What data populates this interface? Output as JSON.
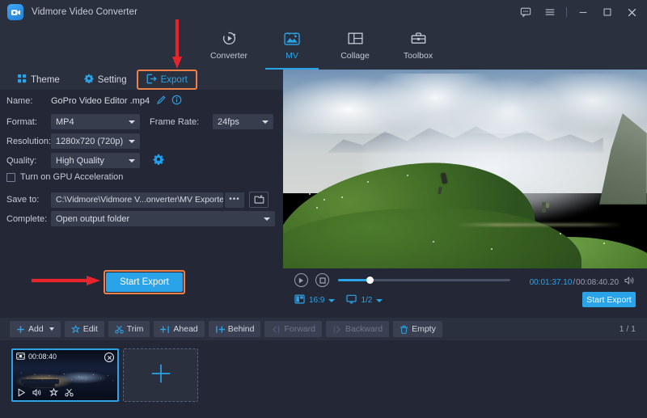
{
  "window": {
    "app_title": "Vidmore Video Converter",
    "logo_icon": "video-camera-icon",
    "controls": {
      "feedback_label": "feedback-icon",
      "menu_label": "hamburger-menu-icon",
      "minimize_label": "minimize-icon",
      "maximize_label": "maximize-icon",
      "close_label": "close-icon"
    }
  },
  "mainnav": {
    "items": [
      {
        "label": "Converter",
        "icon": "converter-icon",
        "active": false
      },
      {
        "label": "MV",
        "icon": "mv-icon",
        "active": true
      },
      {
        "label": "Collage",
        "icon": "collage-icon",
        "active": false
      },
      {
        "label": "Toolbox",
        "icon": "toolbox-icon",
        "active": false
      }
    ]
  },
  "subnav": {
    "items": [
      {
        "label": "Theme",
        "icon": "grid-icon",
        "active": false
      },
      {
        "label": "Setting",
        "icon": "gear-icon",
        "active": false
      },
      {
        "label": "Export",
        "icon": "export-icon",
        "active": true,
        "highlighted": true
      }
    ]
  },
  "export_form": {
    "name_label": "Name:",
    "name_value": "GoPro Video Editor .mp4",
    "name_edit_icon": "pencil-icon",
    "name_info_icon": "info-icon",
    "format_label": "Format:",
    "format_value": "MP4",
    "frame_rate_label": "Frame Rate:",
    "frame_rate_value": "24fps",
    "resolution_label": "Resolution:",
    "resolution_value": "1280x720 (720p)",
    "quality_label": "Quality:",
    "quality_value": "High Quality",
    "quality_settings_icon": "gear-icon",
    "gpu_label": "Turn on GPU Acceleration",
    "gpu_checked": false,
    "save_to_label": "Save to:",
    "save_to_value": "C:\\Vidmore\\Vidmore V...onverter\\MV Exported",
    "browse_ellipsis_label": "•••",
    "folder_icon": "folder-icon",
    "complete_label": "Complete:",
    "complete_value": "Open output folder",
    "start_export_label": "Start Export"
  },
  "annotations": {
    "arrow_color": "#e8242a",
    "highlight_color": "#ee8149"
  },
  "player": {
    "play_icon": "play-icon",
    "stop_icon": "stop-icon",
    "progress_percent": 18.7,
    "current_time": "00:01:37.10",
    "time_separator": "/",
    "total_time": "00:08:40.20",
    "volume_icon": "volume-icon",
    "aspect_icon": "aspect-ratio-icon",
    "aspect_value": "16:9",
    "screen_icon": "monitor-icon",
    "screen_value": "1/2",
    "start_export_label": "Start Export"
  },
  "toolbar": {
    "buttons": [
      {
        "label": "Add",
        "icon": "plus-icon",
        "disabled": false,
        "has_caret": true
      },
      {
        "label": "Edit",
        "icon": "magic-wand-icon",
        "disabled": false,
        "has_caret": false
      },
      {
        "label": "Trim",
        "icon": "scissors-icon",
        "disabled": false,
        "has_caret": false
      },
      {
        "label": "Ahead",
        "icon": "insert-ahead-icon",
        "disabled": false,
        "has_caret": false
      },
      {
        "label": "Behind",
        "icon": "insert-behind-icon",
        "disabled": false,
        "has_caret": false
      },
      {
        "label": "Forward",
        "icon": "move-forward-icon",
        "disabled": true,
        "has_caret": false
      },
      {
        "label": "Backward",
        "icon": "move-backward-icon",
        "disabled": true,
        "has_caret": false
      },
      {
        "label": "Empty",
        "icon": "trash-icon",
        "disabled": false,
        "has_caret": false
      }
    ],
    "page_indicator": "1 / 1"
  },
  "strip": {
    "clip": {
      "duration": "00:08:40",
      "film_icon": "film-strip-icon",
      "close_icon": "close-circle-icon",
      "play_icon": "play-icon",
      "volume_icon": "volume-icon",
      "effect_icon": "magic-wand-icon",
      "trim_icon": "scissors-icon"
    },
    "add_card_icon": "plus-icon"
  },
  "colors": {
    "accent": "#2aa3e8",
    "panel": "#2b303f",
    "background": "#242836",
    "field": "#383d4d",
    "highlight": "#ee8149",
    "arrow": "#e8242a"
  }
}
